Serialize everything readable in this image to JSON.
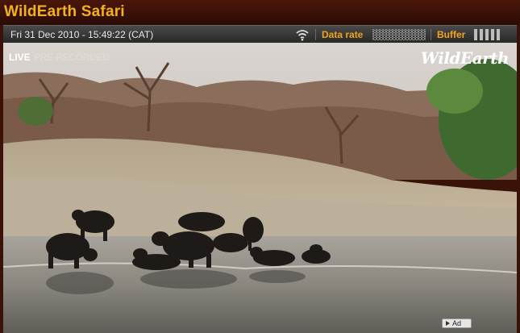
{
  "window": {
    "title": "WildEarth Safari"
  },
  "infobar": {
    "datetime": "Fri 31 Dec 2010 - 15:49:22 (CAT)",
    "signal_icon": "wifi-icon",
    "data_rate_label": "Data rate",
    "buffer_label": "Buffer"
  },
  "video": {
    "live_label": "LIVE",
    "recorded_label": "PRE-RECORDED",
    "logo_text": "WildEarth",
    "ad_label": "Ad"
  },
  "colors": {
    "accent": "#f2a21c",
    "title_bar": "#3a1208",
    "info_bar": "#333333"
  }
}
